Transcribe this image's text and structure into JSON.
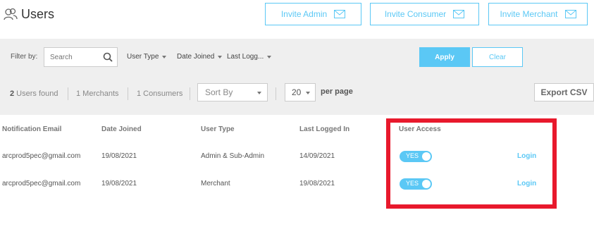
{
  "header": {
    "title": "Users",
    "invite_admin": "Invite Admin",
    "invite_consumer": "Invite Consumer",
    "invite_merchant": "Invite Merchant"
  },
  "filters": {
    "label": "Filter by:",
    "search_placeholder": "Search",
    "user_type": "User Type",
    "date_joined": "Date Joined",
    "last_logged": "Last Logg...",
    "apply": "Apply",
    "clear": "Clear"
  },
  "summary": {
    "users_count": "2",
    "users_label": " Users found",
    "merchants_count": "1",
    "merchants_label": " Merchants",
    "consumers_count": "1",
    "consumers_label": " Consumers",
    "sort_by": "Sort By",
    "per_page_value": "20",
    "per_page_label": "per page",
    "export": "Export CSV"
  },
  "table": {
    "columns": [
      "Notification Email",
      "Date Joined",
      "User Type",
      "Last Logged In",
      "User Access"
    ],
    "rows": [
      {
        "email": "arcprod5pec@gmail.com",
        "date_joined": "19/08/2021",
        "user_type": "Admin & Sub-Admin",
        "last_logged_in": "14/09/2021",
        "access": "YES",
        "action": "Login"
      },
      {
        "email": "arcprod5pec@gmail.com",
        "date_joined": "19/08/2021",
        "user_type": "Merchant",
        "last_logged_in": "19/08/2021",
        "access": "YES",
        "action": "Login"
      }
    ]
  },
  "colors": {
    "accent": "#5bc8f5",
    "highlight": "#e8192c",
    "bar_bg": "#efefef"
  }
}
